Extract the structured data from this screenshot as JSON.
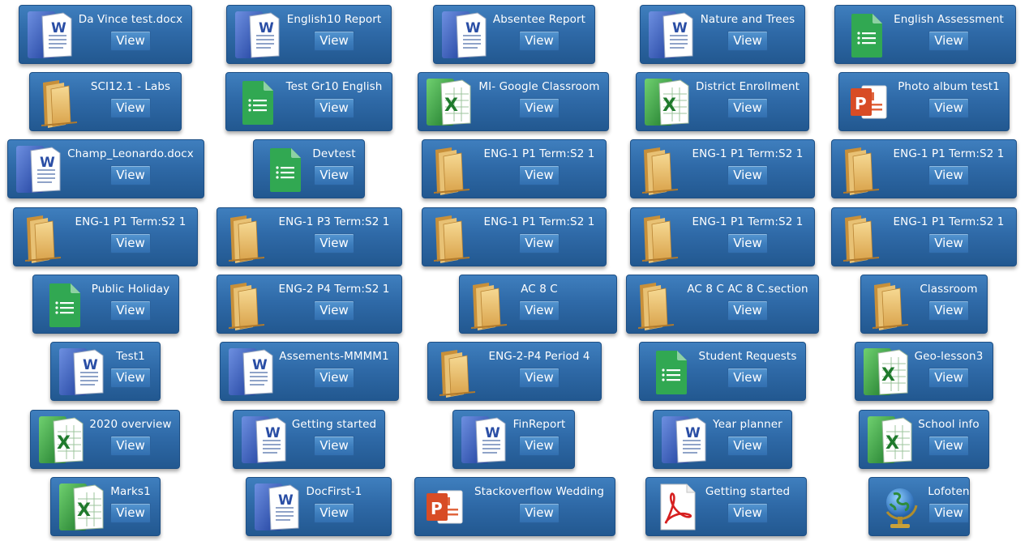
{
  "files": [
    {
      "name": "Da Vince test.docx",
      "icon": "word-document-icon",
      "button": "View"
    },
    {
      "name": "English10 Report",
      "icon": "word-document-icon",
      "button": "View"
    },
    {
      "name": "Absentee Report",
      "icon": "word-document-icon",
      "button": "View"
    },
    {
      "name": "Nature and Trees",
      "icon": "word-document-icon",
      "button": "View"
    },
    {
      "name": "English Assessment",
      "icon": "google-sheets-icon",
      "button": "View"
    },
    {
      "name": "SCI12.1 - Labs",
      "icon": "folder-icon",
      "button": "View"
    },
    {
      "name": "Test Gr10 English",
      "icon": "google-sheets-icon",
      "button": "View"
    },
    {
      "name": "MI- Google Classroom",
      "icon": "excel-spreadsheet-icon",
      "button": "View"
    },
    {
      "name": "District Enrollment",
      "icon": "excel-spreadsheet-icon",
      "button": "View"
    },
    {
      "name": "Photo album test1",
      "icon": "powerpoint-icon",
      "button": "View"
    },
    {
      "name": "Champ_Leonardo.docx",
      "icon": "word-document-icon",
      "button": "View"
    },
    {
      "name": "Devtest",
      "icon": "google-sheets-icon",
      "button": "View"
    },
    {
      "name": "ENG-1 P1 Term:S2 1",
      "icon": "folder-icon",
      "button": "View"
    },
    {
      "name": "ENG-1 P1 Term:S2 1",
      "icon": "folder-icon",
      "button": "View"
    },
    {
      "name": "ENG-1 P1 Term:S2 1",
      "icon": "folder-icon",
      "button": "View"
    },
    {
      "name": "ENG-1 P1 Term:S2 1",
      "icon": "folder-icon",
      "button": "View"
    },
    {
      "name": "ENG-1 P3 Term:S2 1",
      "icon": "folder-icon",
      "button": "View"
    },
    {
      "name": "ENG-1 P1 Term:S2 1",
      "icon": "folder-icon",
      "button": "View"
    },
    {
      "name": "ENG-1 P1 Term:S2 1",
      "icon": "folder-icon",
      "button": "View"
    },
    {
      "name": "ENG-1 P1 Term:S2 1",
      "icon": "folder-icon",
      "button": "View"
    },
    {
      "name": "Public Holiday",
      "icon": "google-sheets-icon",
      "button": "View"
    },
    {
      "name": "ENG-2 P4 Term:S2 1",
      "icon": "folder-icon",
      "button": "View"
    },
    {
      "name": "AC 8 C",
      "icon": "folder-icon",
      "button": "View"
    },
    {
      "name": "AC 8 C AC 8 C.section",
      "icon": "folder-icon",
      "button": "View"
    },
    {
      "name": "Classroom",
      "icon": "folder-icon",
      "button": "View"
    },
    {
      "name": "Test1",
      "icon": "word-document-icon",
      "button": "View"
    },
    {
      "name": "Assements-MMMM1",
      "icon": "word-document-icon",
      "button": "View"
    },
    {
      "name": "ENG-2-P4 Period 4",
      "icon": "folder-icon",
      "button": "View"
    },
    {
      "name": "Student Requests",
      "icon": "google-sheets-icon",
      "button": "View"
    },
    {
      "name": "Geo-lesson3",
      "icon": "excel-spreadsheet-icon",
      "button": "View"
    },
    {
      "name": "2020 overview",
      "icon": "excel-spreadsheet-icon",
      "button": "View"
    },
    {
      "name": "Getting started",
      "icon": "word-document-icon",
      "button": "View"
    },
    {
      "name": "FinReport",
      "icon": "word-document-icon",
      "button": "View"
    },
    {
      "name": "Year planner",
      "icon": "word-document-icon",
      "button": "View"
    },
    {
      "name": "School info",
      "icon": "excel-spreadsheet-icon",
      "button": "View"
    },
    {
      "name": "Marks1",
      "icon": "excel-spreadsheet-icon",
      "button": "View"
    },
    {
      "name": "DocFirst-1",
      "icon": "word-document-icon",
      "button": "View"
    },
    {
      "name": "Stackoverflow Wedding",
      "icon": "powerpoint-icon",
      "button": "View"
    },
    {
      "name": "Getting started",
      "icon": "pdf-icon",
      "button": "View"
    },
    {
      "name": "Lofoten",
      "icon": "globe-icon",
      "button": "View"
    }
  ]
}
